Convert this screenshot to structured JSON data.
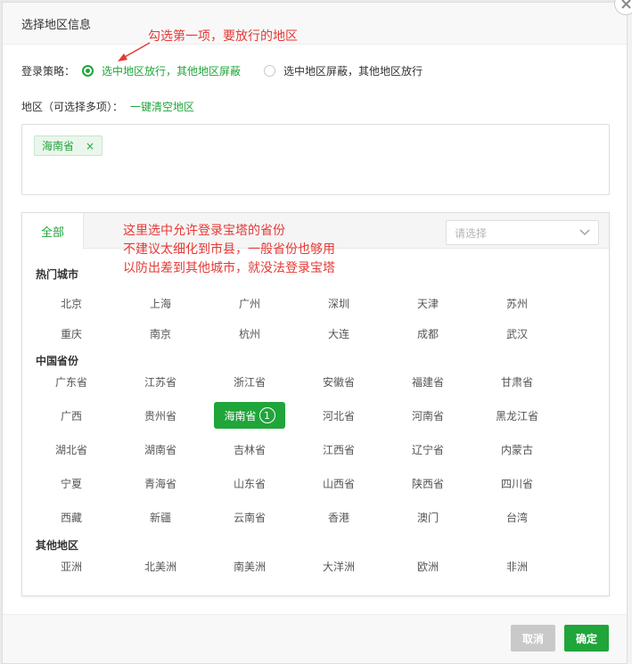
{
  "dialog": {
    "title": "选择地区信息"
  },
  "annotations": {
    "top": "勾选第一项，要放行的地区",
    "panel_line1": "这里选中允许登录宝塔的省份",
    "panel_line2": "不建议太细化到市县，一般省份也够用",
    "panel_line3": "以防出差到其他城市，就没法登录宝塔"
  },
  "policy": {
    "label": "登录策略：",
    "options": [
      {
        "label": "选中地区放行，其他地区屏蔽",
        "checked": true
      },
      {
        "label": "选中地区屏蔽，其他地区放行",
        "checked": false
      }
    ]
  },
  "region": {
    "label": "地区（可选择多项）：",
    "clear_link": "一键清空地区"
  },
  "selected_tags": [
    {
      "label": "海南省",
      "close": "×"
    }
  ],
  "panel": {
    "tab_all": "全部",
    "select_placeholder": "请选择",
    "groups": [
      {
        "title": "热门城市",
        "items": [
          "北京",
          "上海",
          "广州",
          "深圳",
          "天津",
          "苏州",
          "重庆",
          "南京",
          "杭州",
          "大连",
          "成都",
          "武汉"
        ]
      },
      {
        "title": "中国省份",
        "items": [
          "广东省",
          "江苏省",
          "浙江省",
          "安徽省",
          "福建省",
          "甘肃省",
          "广西",
          "贵州省",
          "海南省",
          "河北省",
          "河南省",
          "黑龙江省",
          "湖北省",
          "湖南省",
          "吉林省",
          "江西省",
          "辽宁省",
          "内蒙古",
          "宁夏",
          "青海省",
          "山东省",
          "山西省",
          "陕西省",
          "四川省",
          "西藏",
          "新疆",
          "云南省",
          "香港",
          "澳门",
          "台湾"
        ]
      },
      {
        "title": "其他地区",
        "items": [
          "亚洲",
          "北美洲",
          "南美洲",
          "大洋洲",
          "欧洲",
          "非洲"
        ]
      }
    ],
    "selected_badge": "1"
  },
  "footer": {
    "cancel": "取消",
    "confirm": "确定"
  },
  "colors": {
    "accent": "#20a53a",
    "annotation": "#e53935"
  }
}
